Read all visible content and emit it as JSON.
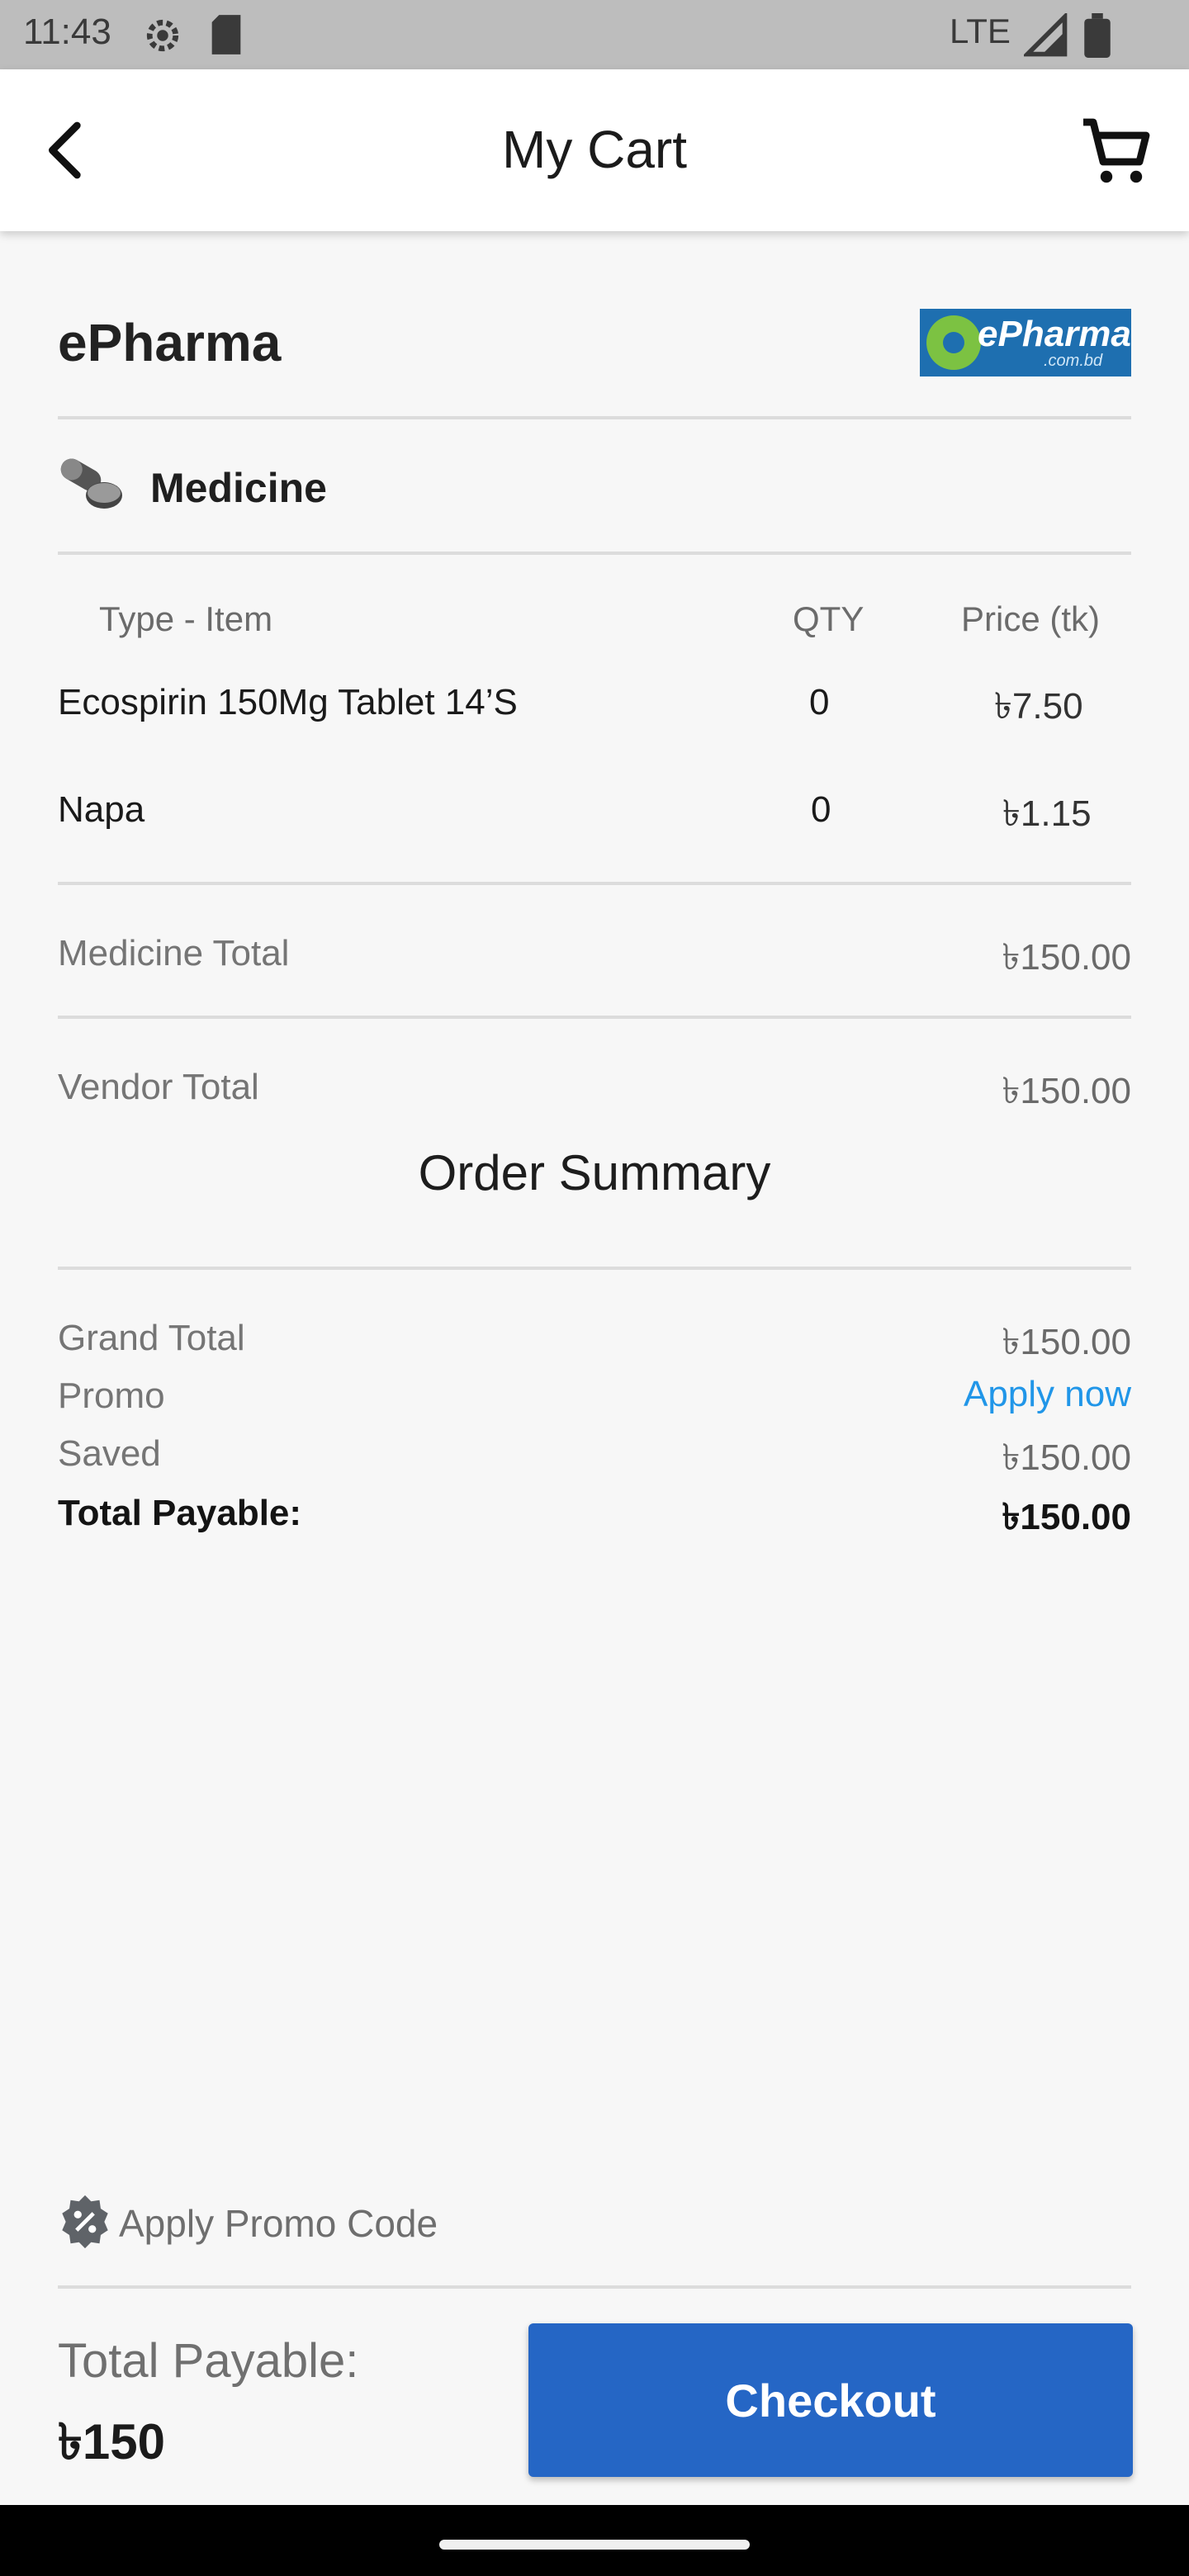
{
  "status_bar": {
    "time": "11:43",
    "network": "LTE"
  },
  "app_bar": {
    "title": "My Cart"
  },
  "vendor": {
    "name": "ePharma",
    "logo_text": "ePharma",
    "logo_sub": ".com.bd"
  },
  "category": {
    "label": "Medicine"
  },
  "table": {
    "headers": {
      "item": "Type - Item",
      "qty": "QTY",
      "price": "Price (tk)"
    },
    "rows": [
      {
        "name": "Ecospirin 150Mg Tablet 14’S",
        "qty": "0",
        "price": "৳7.50"
      },
      {
        "name": "Napa",
        "qty": "0",
        "price": "৳1.15"
      }
    ]
  },
  "medicine_total": {
    "label": "Medicine Total",
    "value": "৳150.00"
  },
  "vendor_total": {
    "label": "Vendor Total",
    "value": "৳150.00"
  },
  "order_summary": {
    "title": "Order Summary",
    "grand_total": {
      "label": "Grand Total",
      "value": "৳150.00"
    },
    "promo": {
      "label": "Promo",
      "value": "Apply now"
    },
    "saved": {
      "label": "Saved",
      "value": "৳150.00"
    },
    "total_payable": {
      "label": "Total Payable:",
      "value": "৳150.00"
    }
  },
  "promo_code": {
    "label": "Apply Promo Code"
  },
  "footer": {
    "label": "Total Payable:",
    "amount": "৳150",
    "checkout_label": "Checkout"
  },
  "colors": {
    "accent": "#2566c5",
    "link": "#2196e8",
    "logo_bg": "#1e6fb0",
    "logo_leaf": "#7cc242"
  }
}
